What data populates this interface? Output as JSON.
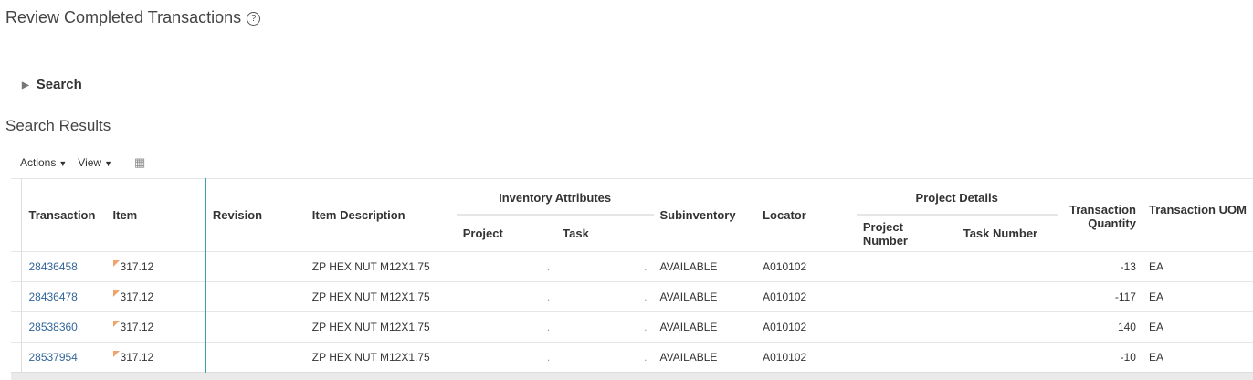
{
  "page": {
    "title": "Review Completed Transactions",
    "help_icon": "?"
  },
  "search": {
    "label": "Search"
  },
  "results": {
    "title": "Search Results"
  },
  "toolbar": {
    "actions": "Actions",
    "view": "View",
    "freeze_icon": "freeze-columns-icon"
  },
  "columns": {
    "transaction": "Transaction",
    "item": "Item",
    "revision": "Revision",
    "item_description": "Item Description",
    "inventory_attributes": "Inventory Attributes",
    "project": "Project",
    "task": "Task",
    "subinventory": "Subinventory",
    "locator": "Locator",
    "project_details": "Project Details",
    "project_number": "Project Number",
    "task_number": "Task Number",
    "transaction_quantity": "Transaction Quantity",
    "transaction_uom": "Transaction UOM"
  },
  "rows": [
    {
      "transaction": "28436458",
      "item": "317.12",
      "revision": "",
      "description": "ZP HEX NUT M12X1.75",
      "project": ".",
      "task": ".",
      "subinventory": "AVAILABLE",
      "locator": "A010102",
      "project_number": "",
      "task_number": "",
      "quantity": "-13",
      "uom": "EA"
    },
    {
      "transaction": "28436478",
      "item": "317.12",
      "revision": "",
      "description": "ZP HEX NUT M12X1.75",
      "project": ".",
      "task": ".",
      "subinventory": "AVAILABLE",
      "locator": "A010102",
      "project_number": "",
      "task_number": "",
      "quantity": "-117",
      "uom": "EA"
    },
    {
      "transaction": "28538360",
      "item": "317.12",
      "revision": "",
      "description": "ZP HEX NUT M12X1.75",
      "project": ".",
      "task": ".",
      "subinventory": "AVAILABLE",
      "locator": "A010102",
      "project_number": "",
      "task_number": "",
      "quantity": "140",
      "uom": "EA"
    },
    {
      "transaction": "28537954",
      "item": "317.12",
      "revision": "",
      "description": "ZP HEX NUT M12X1.75",
      "project": ".",
      "task": ".",
      "subinventory": "AVAILABLE",
      "locator": "A010102",
      "project_number": "",
      "task_number": "",
      "quantity": "-10",
      "uom": "EA"
    }
  ]
}
